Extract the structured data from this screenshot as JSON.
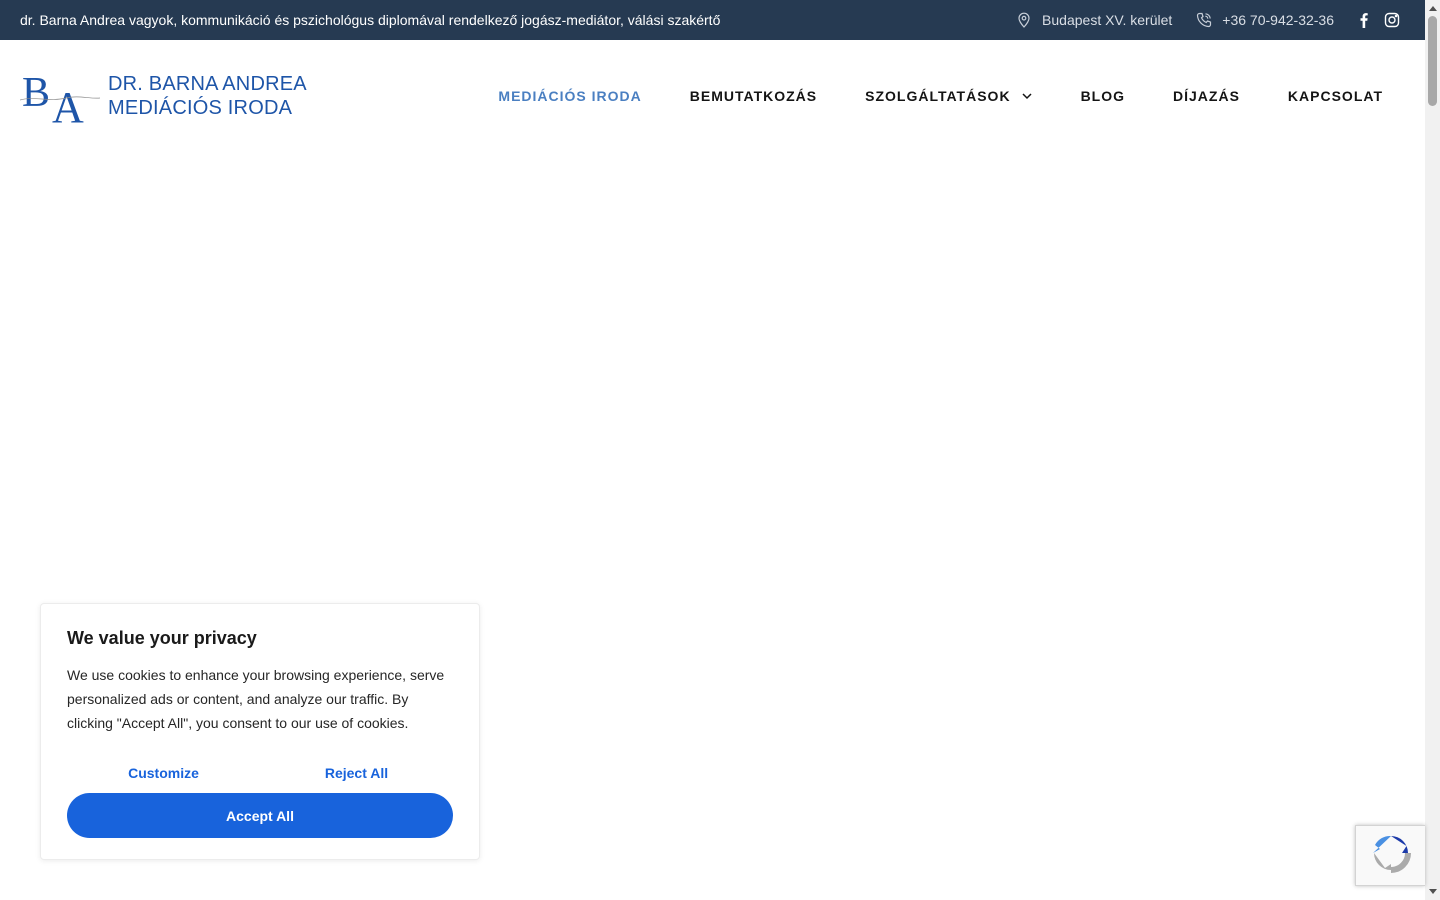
{
  "topbar": {
    "tagline": "dr. Barna Andrea vagyok, kommunikáció és pszichológus diplomával rendelkező jogász-mediátor, válási szakértő",
    "location": "Budapest XV. kerület",
    "phone": "+36 70-942-32-36",
    "location_icon": "map-pin-icon",
    "phone_icon": "phone-icon",
    "social": [
      "facebook-icon",
      "instagram-icon"
    ]
  },
  "logo": {
    "line1": "DR. BARNA ANDREA",
    "line2": "MEDIÁCIÓS IRODA",
    "brand_color": "#1e55a8"
  },
  "nav": {
    "items": [
      {
        "label": "MEDIÁCIÓS IRODA",
        "active": true
      },
      {
        "label": "BEMUTATKOZÁS"
      },
      {
        "label": "SZOLGÁLTATÁSOK",
        "has_dropdown": true
      },
      {
        "label": "BLOG"
      },
      {
        "label": "DÍJAZÁS"
      },
      {
        "label": "KAPCSOLAT"
      }
    ],
    "active_color": "#4a7fc1"
  },
  "cookie": {
    "title": "We value your privacy",
    "text": "We use cookies to enhance your browsing experience, serve personalized ads or content, and analyze our traffic. By clicking \"Accept All\", you consent to our use of cookies.",
    "customize_label": "Customize",
    "reject_label": "Reject All",
    "accept_label": "Accept All",
    "accent_color": "#1863dc"
  },
  "colors": {
    "topbar_bg": "#263a52"
  }
}
